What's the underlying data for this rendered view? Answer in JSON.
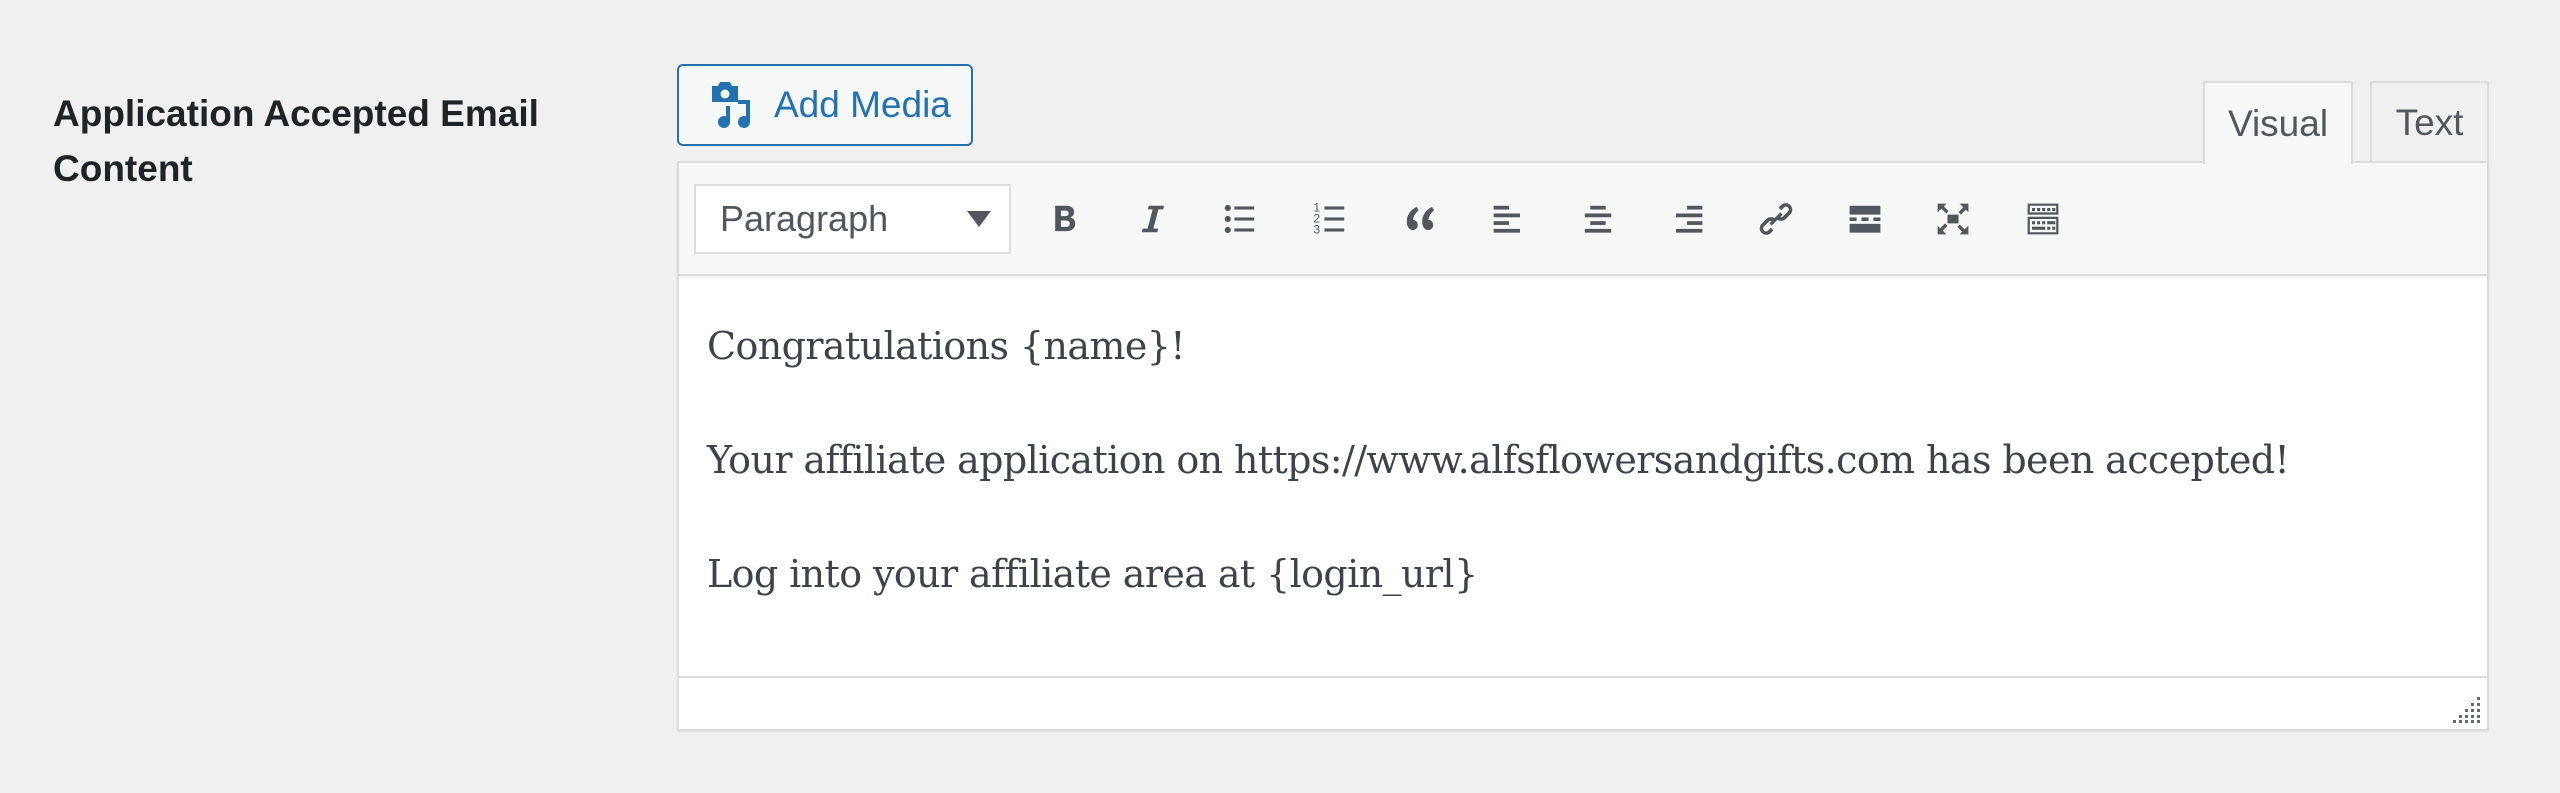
{
  "field": {
    "label": "Application Accepted Email Content"
  },
  "media": {
    "add_media_label": "Add Media",
    "icon": "camera-music-icon"
  },
  "tabs": [
    {
      "label": "Visual",
      "active": true
    },
    {
      "label": "Text",
      "active": false
    }
  ],
  "toolbar": {
    "format_select": {
      "value": "Paragraph"
    },
    "buttons": [
      {
        "name": "bold",
        "icon": "bold-icon"
      },
      {
        "name": "italic",
        "icon": "italic-icon"
      },
      {
        "name": "bulleted-list",
        "icon": "bulleted-list-icon"
      },
      {
        "name": "numbered-list",
        "icon": "numbered-list-icon"
      },
      {
        "name": "blockquote",
        "icon": "blockquote-icon"
      },
      {
        "name": "align-left",
        "icon": "align-left-icon"
      },
      {
        "name": "align-center",
        "icon": "align-center-icon"
      },
      {
        "name": "align-right",
        "icon": "align-right-icon"
      },
      {
        "name": "insert-link",
        "icon": "link-icon"
      },
      {
        "name": "read-more",
        "icon": "read-more-icon"
      },
      {
        "name": "fullscreen",
        "icon": "fullscreen-icon"
      },
      {
        "name": "toolbar-toggle",
        "icon": "toolbar-toggle-icon"
      }
    ]
  },
  "content": {
    "paragraphs": [
      "Congratulations {name}!",
      "Your affiliate application on https://www.alfsflowersandgifts.com has been accepted!",
      "Log into your affiliate area at {login_url}"
    ]
  },
  "colors": {
    "accent": "#2271b1",
    "icon": "#50575e",
    "background": "#f0f0f1",
    "text": "#1d2327"
  }
}
